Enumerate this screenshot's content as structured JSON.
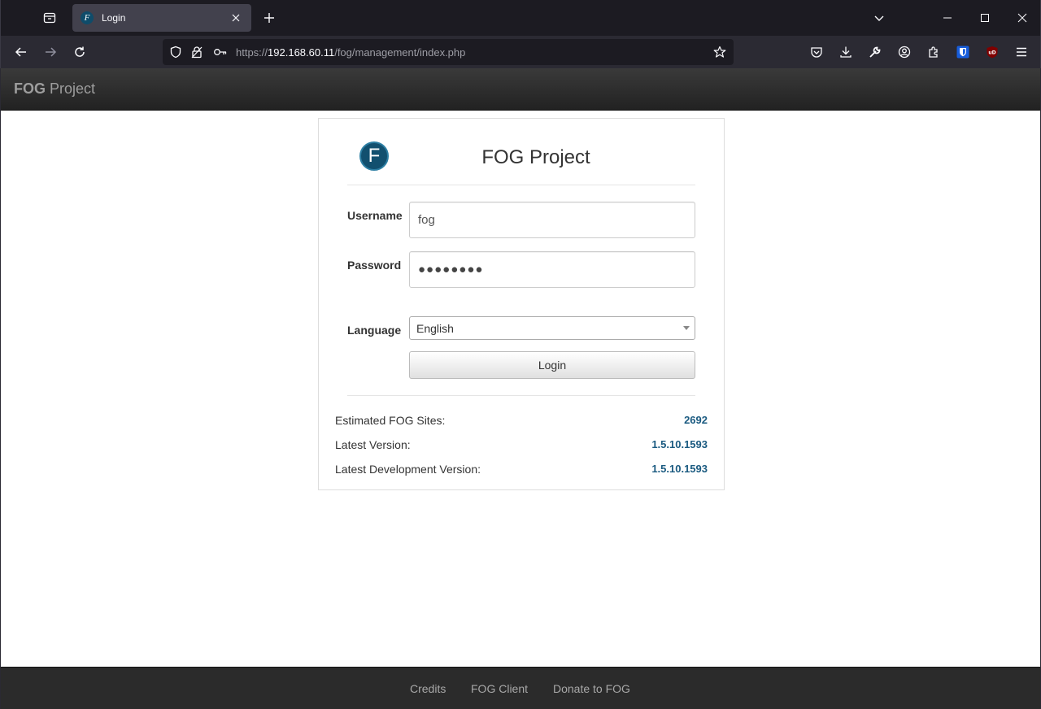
{
  "browser": {
    "tab": {
      "title": "Login",
      "favicon_letter": "F"
    },
    "url": {
      "scheme": "https://",
      "host": "192.168.60.11",
      "path": "/fog/management/index.php"
    }
  },
  "site": {
    "brand_bold": "FOG",
    "brand_rest": " Project"
  },
  "login": {
    "logo_letter": "F",
    "title": "FOG Project",
    "username_label": "Username",
    "username_value": "fog",
    "password_label": "Password",
    "password_mask": "●●●●●●●●",
    "language_label": "Language",
    "language_selected": "English",
    "login_button": "Login"
  },
  "stats": [
    {
      "label": "Estimated FOG Sites:",
      "value": "2692"
    },
    {
      "label": "Latest Version:",
      "value": "1.5.10.1593"
    },
    {
      "label": "Latest Development Version:",
      "value": "1.5.10.1593"
    }
  ],
  "footer": {
    "credits": "Credits",
    "fog_client": "FOG Client",
    "donate": "Donate to FOG"
  },
  "colors": {
    "accent_value": "#1a5a80",
    "logo_bg": "#12506f",
    "chrome_bg": "#1c1b22"
  }
}
